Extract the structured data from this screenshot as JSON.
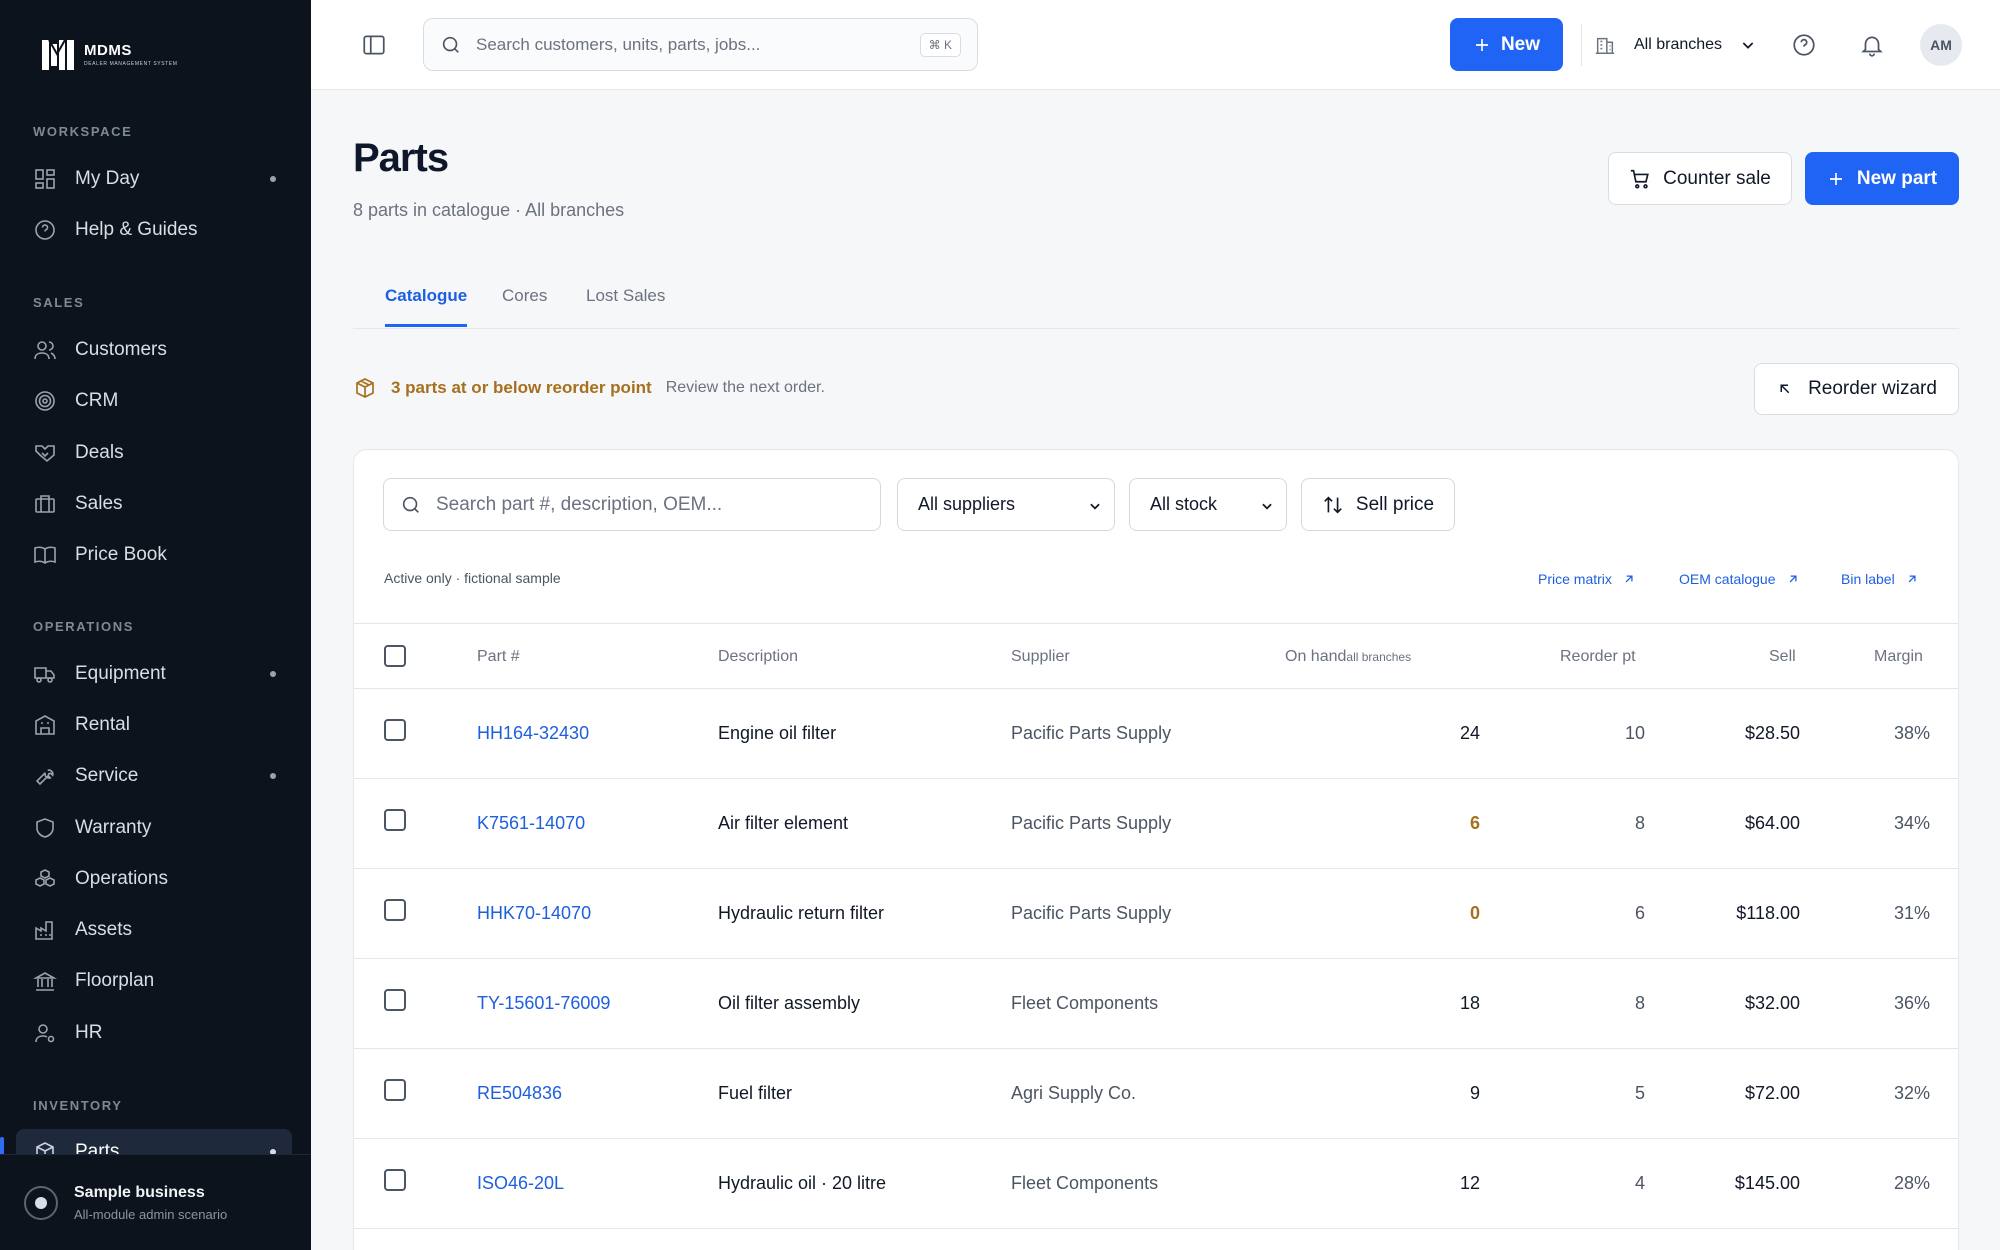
{
  "brand": {
    "name": "MDMS",
    "tagline": "DEALER MANAGEMENT SYSTEM"
  },
  "sidebar": {
    "sections": [
      {
        "title": "WORKSPACE",
        "items": [
          {
            "label": "My Day",
            "icon": "dashboard-icon",
            "dot": true
          },
          {
            "label": "Help & Guides",
            "icon": "help-circle-icon",
            "dot": false
          }
        ]
      },
      {
        "title": "SALES",
        "items": [
          {
            "label": "Customers",
            "icon": "users-icon",
            "dot": false
          },
          {
            "label": "CRM",
            "icon": "target-icon",
            "dot": false
          },
          {
            "label": "Deals",
            "icon": "handshake-icon",
            "dot": false
          },
          {
            "label": "Sales",
            "icon": "briefcase-icon",
            "dot": false
          },
          {
            "label": "Price Book",
            "icon": "book-icon",
            "dot": false
          }
        ]
      },
      {
        "title": "OPERATIONS",
        "items": [
          {
            "label": "Equipment",
            "icon": "truck-icon",
            "dot": true
          },
          {
            "label": "Rental",
            "icon": "building-icon",
            "dot": false
          },
          {
            "label": "Service",
            "icon": "wrench-icon",
            "dot": true
          },
          {
            "label": "Warranty",
            "icon": "shield-icon",
            "dot": false
          },
          {
            "label": "Operations",
            "icon": "cubes-icon",
            "dot": false
          },
          {
            "label": "Assets",
            "icon": "factory-icon",
            "dot": false
          },
          {
            "label": "Floorplan",
            "icon": "bank-icon",
            "dot": false
          },
          {
            "label": "HR",
            "icon": "user-gear-icon",
            "dot": false
          }
        ]
      },
      {
        "title": "INVENTORY",
        "items": [
          {
            "label": "Parts",
            "icon": "package-icon",
            "dot": true,
            "active": true
          }
        ]
      }
    ],
    "footer": {
      "title": "Sample business",
      "subtitle": "All-module admin scenario"
    }
  },
  "topbar": {
    "search_placeholder": "Search customers, units, parts, jobs...",
    "shortcut": "⌘ K",
    "new_label": "New",
    "branch": "All branches",
    "avatar": "AM"
  },
  "page": {
    "title": "Parts",
    "subtitle": "8 parts in catalogue · All branches",
    "counter_sale": "Counter sale",
    "new_part": "New part",
    "tabs": [
      "Catalogue",
      "Cores",
      "Lost Sales"
    ],
    "active_tab": 0,
    "alert_strong": "3 parts at or below reorder point",
    "alert_soft": "Review the next order.",
    "reorder_wizard": "Reorder wizard"
  },
  "filters": {
    "search_placeholder": "Search part #, description, OEM...",
    "supplier": "All suppliers",
    "stock": "All stock",
    "sort": "Sell price",
    "meta": "Active only · fictional sample",
    "links": [
      "Price matrix",
      "OEM catalogue",
      "Bin label"
    ]
  },
  "table": {
    "headers": {
      "part": "Part #",
      "desc": "Description",
      "supplier": "Supplier",
      "onhand": "On hand",
      "onhand_sub": "all branches",
      "reorder": "Reorder pt",
      "sell": "Sell",
      "margin": "Margin"
    },
    "rows": [
      {
        "part": "HH164-32430",
        "desc": "Engine oil filter",
        "supplier": "Pacific Parts Supply",
        "onhand": "24",
        "reorder": "10",
        "sell": "$28.50",
        "margin": "38%",
        "low": false
      },
      {
        "part": "K7561-14070",
        "desc": "Air filter element",
        "supplier": "Pacific Parts Supply",
        "onhand": "6",
        "reorder": "8",
        "sell": "$64.00",
        "margin": "34%",
        "low": true
      },
      {
        "part": "HHK70-14070",
        "desc": "Hydraulic return filter",
        "supplier": "Pacific Parts Supply",
        "onhand": "0",
        "reorder": "6",
        "sell": "$118.00",
        "margin": "31%",
        "low": true
      },
      {
        "part": "TY-15601-76009",
        "desc": "Oil filter assembly",
        "supplier": "Fleet Components",
        "onhand": "18",
        "reorder": "8",
        "sell": "$32.00",
        "margin": "36%",
        "low": false
      },
      {
        "part": "RE504836",
        "desc": "Fuel filter",
        "supplier": "Agri Supply Co.",
        "onhand": "9",
        "reorder": "5",
        "sell": "$72.00",
        "margin": "32%",
        "low": false
      },
      {
        "part": "ISO46-20L",
        "desc": "Hydraulic oil · 20 litre",
        "supplier": "Fleet Components",
        "onhand": "12",
        "reorder": "4",
        "sell": "$145.00",
        "margin": "28%",
        "low": false
      }
    ]
  },
  "colors": {
    "accent": "#2064f5",
    "warning": "#a6701e",
    "sidebar_bg": "#0d131c"
  }
}
